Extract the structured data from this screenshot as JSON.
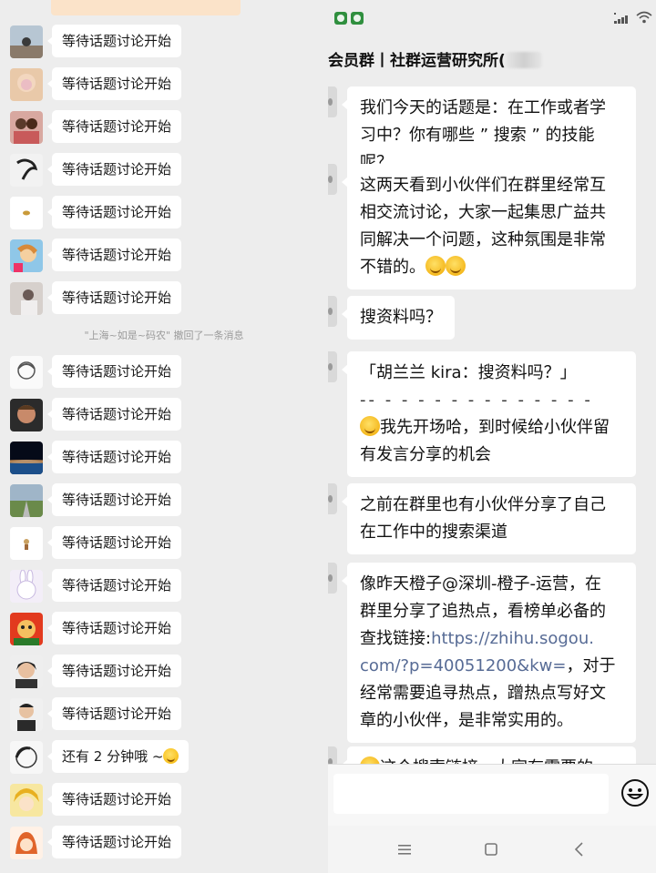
{
  "left_panel": {
    "top_bubble_text": "",
    "messages": [
      {
        "text": "等待话题讨论开始",
        "avatar": "avatar-landscape"
      },
      {
        "text": "等待话题讨论开始",
        "avatar": "avatar-face-blur"
      },
      {
        "text": "等待话题讨论开始",
        "avatar": "avatar-couple"
      },
      {
        "text": "等待话题讨论开始",
        "avatar": "avatar-ink"
      },
      {
        "text": "等待话题讨论开始",
        "avatar": "avatar-small-bird"
      },
      {
        "text": "等待话题讨论开始",
        "avatar": "avatar-cartoon-girl"
      },
      {
        "text": "等待话题讨论开始",
        "avatar": "avatar-outdoor"
      }
    ],
    "recall_notice": "\"上海~如是~码农\" 撤回了一条消息",
    "messages_after": [
      {
        "text": "等待话题讨论开始",
        "avatar": "avatar-sketch-girl"
      },
      {
        "text": "等待话题讨论开始",
        "avatar": "avatar-man-portrait"
      },
      {
        "text": "等待话题讨论开始",
        "avatar": "avatar-earth"
      },
      {
        "text": "等待话题讨论开始",
        "avatar": "avatar-road"
      },
      {
        "text": "等待话题讨论开始",
        "avatar": "avatar-small-figure"
      },
      {
        "text": "等待话题讨论开始",
        "avatar": "avatar-bunny-cartoon"
      },
      {
        "text": "等待话题讨论开始",
        "avatar": "avatar-red-cartoon"
      },
      {
        "text": "等待话题讨论开始",
        "avatar": "avatar-woman-dark"
      },
      {
        "text": "等待话题讨论开始",
        "avatar": "avatar-man-light"
      },
      {
        "text": "还有 2 分钟哦 ~",
        "avatar": "avatar-line-drawing",
        "emoji": true
      },
      {
        "text": "等待话题讨论开始",
        "avatar": "avatar-anime-blonde"
      },
      {
        "text": "等待话题讨论开始",
        "avatar": "avatar-anime-red"
      }
    ]
  },
  "right_panel": {
    "chat_title": "会员群丨社群运营研究所(",
    "messages": [
      {
        "lines": [
          "我们今天的话题是：在工作或者学",
          "习中？你有哪些 ” 搜索 ” 的技能呢？"
        ]
      },
      {
        "lines": [
          "这两天看到小伙伴们在群里经常互",
          "相交流讨论，大家一起集思广益共",
          "同解决一个问题，这种氛围是非常",
          "不错的。"
        ]
      },
      {
        "lines": [
          "搜资料吗？"
        ]
      },
      {
        "lines": [
          "「胡兰兰 kira：搜资料吗？」",
          "-- - - - - - - - - - - - - -",
          "我先开场哈，到时候给小伙伴留",
          "有发言分享的机会"
        ]
      },
      {
        "lines": [
          "之前在群里也有小伙伴分享了自己",
          "在工作中的搜索渠道"
        ]
      },
      {
        "lines": [
          "像昨天橙子@深圳-橙子-运营，在",
          "群里分享了追热点，看榜单必备的",
          "查找链接:",
          "https://zhihu.sogou.",
          "com/?p=40051200&kw=",
          "，对于",
          "经常需要追寻热点，蹭热点写好文",
          "章的小伙伴，是非常实用的。"
        ]
      },
      {
        "lines": [
          "这个搜索链接，大家有需要的"
        ]
      }
    ]
  },
  "colors": {
    "background": "#ededed",
    "bubble": "#ffffff",
    "link": "#576b95",
    "recall_text": "#9b9b9b"
  }
}
